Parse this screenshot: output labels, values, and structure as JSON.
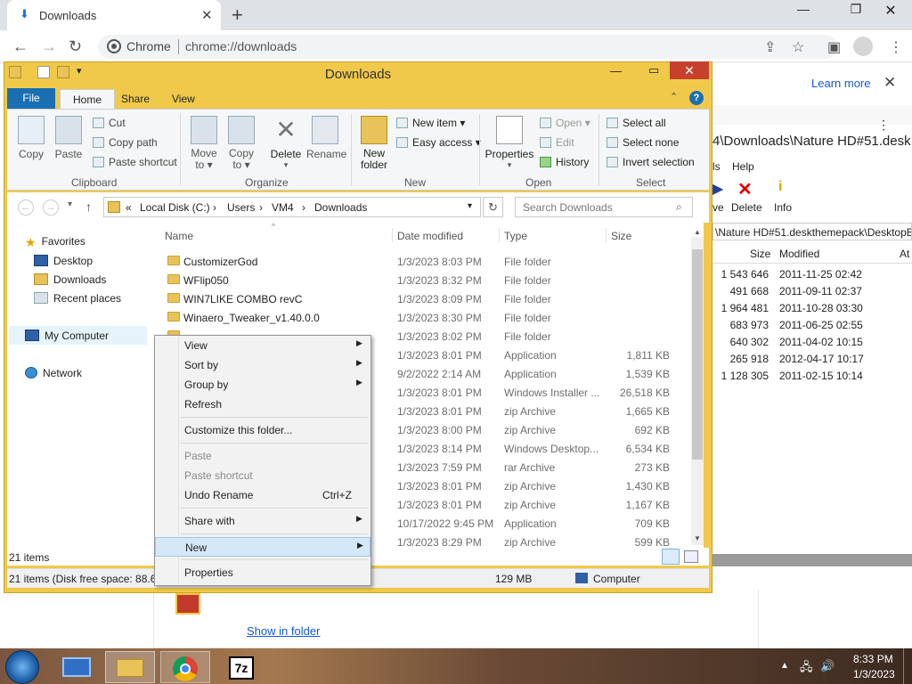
{
  "chrome": {
    "tab_title": "Downloads",
    "tab_close": "✕",
    "new_tab": "+",
    "site_label": "Chrome",
    "url": "chrome://downloads",
    "learn_more": "Learn more",
    "close_banner": "✕",
    "menu_dots": "⋮"
  },
  "downloads_page": {
    "show_in_folder": "Show in folder"
  },
  "explorer": {
    "title": "Downloads",
    "ribbon_tabs": [
      "File",
      "Home",
      "Share",
      "View"
    ],
    "clipboard": {
      "copy": "Copy",
      "paste": "Paste",
      "cut": "Cut",
      "copy_path": "Copy path",
      "paste_shortcut": "Paste shortcut",
      "label": "Clipboard"
    },
    "organize": {
      "move_to": "Move to ▾",
      "copy_to": "Copy to ▾",
      "delete": "Delete",
      "delete_arrow": "▾",
      "rename": "Rename",
      "label": "Organize"
    },
    "new_group": {
      "new_folder": "New folder",
      "new_item": "New item ▾",
      "easy_access": "Easy access ▾",
      "label": "New"
    },
    "open_group": {
      "properties": "Properties",
      "properties_arrow": "▾",
      "open": "Open ▾",
      "edit": "Edit",
      "history": "History",
      "label": "Open"
    },
    "select_group": {
      "select_all": "Select all",
      "select_none": "Select none",
      "invert_selection": "Invert selection",
      "label": "Select"
    },
    "address": {
      "prefix": "«",
      "crumbs": [
        "Local Disk (C:)",
        "Users",
        "VM4",
        "Downloads"
      ],
      "sep": "›"
    },
    "search_placeholder": "Search Downloads",
    "nav": {
      "favorites": "Favorites",
      "desktop": "Desktop",
      "downloads": "Downloads",
      "recent_places": "Recent places",
      "my_computer": "My Computer",
      "network": "Network"
    },
    "columns": {
      "name": "Name",
      "date": "Date modified",
      "type": "Type",
      "size": "Size"
    },
    "files": [
      {
        "name": "CustomizerGod",
        "date": "1/3/2023 8:03 PM",
        "type": "File folder",
        "size": "",
        "folder": true
      },
      {
        "name": "WFlip050",
        "date": "1/3/2023 8:32 PM",
        "type": "File folder",
        "size": "",
        "folder": true
      },
      {
        "name": "WIN7LIKE COMBO revC",
        "date": "1/3/2023 8:09 PM",
        "type": "File folder",
        "size": "",
        "folder": true
      },
      {
        "name": "Winaero_Tweaker_v1.40.0.0",
        "date": "1/3/2023 8:30 PM",
        "type": "File folder",
        "size": "",
        "folder": true
      },
      {
        "name": "",
        "date": "1/3/2023 8:02 PM",
        "type": "File folder",
        "size": "",
        "folder": true
      },
      {
        "name": "",
        "date": "1/3/2023 8:01 PM",
        "type": "Application",
        "size": "1,811 KB",
        "folder": false
      },
      {
        "name": "",
        "date": "9/2/2022 2:14 AM",
        "type": "Application",
        "size": "1,539 KB",
        "folder": false
      },
      {
        "name": "",
        "date": "1/3/2023 8:01 PM",
        "type": "Windows Installer ...",
        "size": "26,518 KB",
        "folder": false
      },
      {
        "name": "",
        "date": "1/3/2023 8:01 PM",
        "type": "zip Archive",
        "size": "1,665 KB",
        "folder": false
      },
      {
        "name": "",
        "date": "1/3/2023 8:00 PM",
        "type": "zip Archive",
        "size": "692 KB",
        "folder": false
      },
      {
        "name": "",
        "date": "1/3/2023 8:14 PM",
        "type": "Windows Desktop...",
        "size": "6,534 KB",
        "folder": false
      },
      {
        "name": "",
        "date": "1/3/2023 7:59 PM",
        "type": "rar Archive",
        "size": "273 KB",
        "folder": false
      },
      {
        "name": "",
        "date": "1/3/2023 8:01 PM",
        "type": "zip Archive",
        "size": "1,430 KB",
        "folder": false
      },
      {
        "name": "",
        "date": "1/3/2023 8:01 PM",
        "type": "zip Archive",
        "size": "1,167 KB",
        "folder": false
      },
      {
        "name": "",
        "date": "10/17/2022 9:45 PM",
        "type": "Application",
        "size": "709 KB",
        "folder": false
      },
      {
        "name": "",
        "date": "1/3/2023 8:29 PM",
        "type": "zip Archive",
        "size": "599 KB",
        "folder": false
      }
    ],
    "items_count": "21 items",
    "status_left": "21 items (Disk free space: 88.6",
    "status_mid": "129 MB",
    "status_right": "Computer"
  },
  "context_menu": {
    "view": "View",
    "sort_by": "Sort by",
    "group_by": "Group by",
    "refresh": "Refresh",
    "customize": "Customize this folder...",
    "paste": "Paste",
    "paste_shortcut": "Paste shortcut",
    "undo_rename": "Undo Rename",
    "undo_shortcut": "Ctrl+Z",
    "share_with": "Share with",
    "new": "New",
    "properties": "Properties",
    "arrow": "▶"
  },
  "bg_window": {
    "path": "4\\Downloads\\Nature HD#51.desk",
    "menu": [
      "ls",
      "Help"
    ],
    "delete": "Delete",
    "info": "Info",
    "path2": "\\Nature HD#51.deskthemepack\\DesktopBa",
    "col_size": "Size",
    "col_modified": "Modified",
    "col_attr": "At",
    "rows": [
      {
        "size": "1 543 646",
        "modified": "2011-11-25 02:42"
      },
      {
        "size": "491 668",
        "modified": "2011-09-11 02:37"
      },
      {
        "size": "1 964 481",
        "modified": "2011-10-28 03:30"
      },
      {
        "size": "683 973",
        "modified": "2011-06-25 02:55"
      },
      {
        "size": "640 302",
        "modified": "2011-04-02 10:15"
      },
      {
        "size": "265 918",
        "modified": "2012-04-17 10:17"
      },
      {
        "size": "1 128 305",
        "modified": "2011-02-15 10:14"
      }
    ]
  },
  "taskbar": {
    "time": "8:33 PM",
    "date": "1/3/2023",
    "sevenzip": "7z"
  },
  "colors": {
    "accent": "#1a6fb3",
    "window_frame": "#f0c94a",
    "link": "#1558d6"
  }
}
